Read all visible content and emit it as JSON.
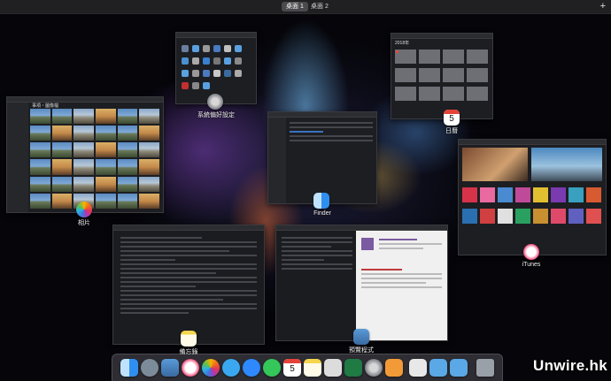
{
  "spaces_bar": {
    "desktops": [
      {
        "label": "桌面 1",
        "active": true
      },
      {
        "label": "桌面 2",
        "active": false
      }
    ],
    "add_label": "+"
  },
  "windows": {
    "system_preferences": {
      "label": "系統偏好設定",
      "icon": "gear-icon"
    },
    "calendar": {
      "label": "日曆",
      "title": "2018年",
      "day": "5",
      "icon": "calendar-icon"
    },
    "photos": {
      "label": "相片",
      "title": "事項・圖像檔",
      "icon": "photos-icon"
    },
    "finder": {
      "label": "Finder",
      "icon": "finder-icon"
    },
    "itunes": {
      "label": "iTunes",
      "icon": "itunes-icon"
    },
    "notes": {
      "label": "備忘錄",
      "icon": "notes-icon"
    },
    "preview": {
      "label": "預覽程式",
      "icon": "preview-icon"
    }
  },
  "dock": {
    "items": [
      {
        "name": "finder",
        "icon": "finder-icon",
        "color": "#2f8ff0"
      },
      {
        "name": "launchpad",
        "icon": "rocket-icon",
        "color": "#7c8b99"
      },
      {
        "name": "preview",
        "icon": "preview-icon",
        "color": "#4a8fd6"
      },
      {
        "name": "itunes",
        "icon": "music-note-icon",
        "color": "#ef4f7a"
      },
      {
        "name": "photos",
        "icon": "photos-icon",
        "color": "#f2f2f2"
      },
      {
        "name": "messages",
        "icon": "speech-bubble-icon",
        "color": "#5bc24e"
      },
      {
        "name": "messenger",
        "icon": "messenger-icon",
        "color": "#2e89ff"
      },
      {
        "name": "whatsapp",
        "icon": "whatsapp-icon",
        "color": "#34c759"
      },
      {
        "name": "calendar",
        "icon": "calendar-icon",
        "color": "#ffffff"
      },
      {
        "name": "notes",
        "icon": "notes-icon",
        "color": "#f5d64e"
      },
      {
        "name": "textedit",
        "icon": "document-icon",
        "color": "#dcdcdc"
      },
      {
        "name": "excel",
        "icon": "excel-icon",
        "color": "#1f7a44"
      },
      {
        "name": "system-preferences",
        "icon": "gear-icon",
        "color": "#8a8d93"
      },
      {
        "name": "home",
        "icon": "home-icon",
        "color": "#f29a38"
      },
      {
        "name": "documents",
        "icon": "document-icon",
        "color": "#e8e8e8"
      },
      {
        "name": "downloads",
        "icon": "folder-icon",
        "color": "#5aa8e6"
      },
      {
        "name": "downloads-2",
        "icon": "folder-icon",
        "color": "#5aa8e6"
      },
      {
        "name": "trash",
        "icon": "trash-icon",
        "color": "#9aa0a8"
      }
    ]
  },
  "watermark": "Unwire.hk"
}
